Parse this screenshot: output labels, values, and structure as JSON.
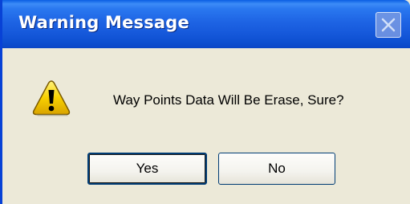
{
  "dialog": {
    "title": "Warning Message",
    "message": "Way Points Data Will Be Erase, Sure?",
    "buttons": {
      "yes_label": "Yes",
      "no_label": "No"
    },
    "icons": {
      "close": "close-icon",
      "warning": "warning-icon"
    }
  },
  "colors": {
    "titlebar": "#1e64e4",
    "dialog_background": "#ece9d8",
    "button_border": "#003c74",
    "warning_fill": "#f8d000"
  }
}
